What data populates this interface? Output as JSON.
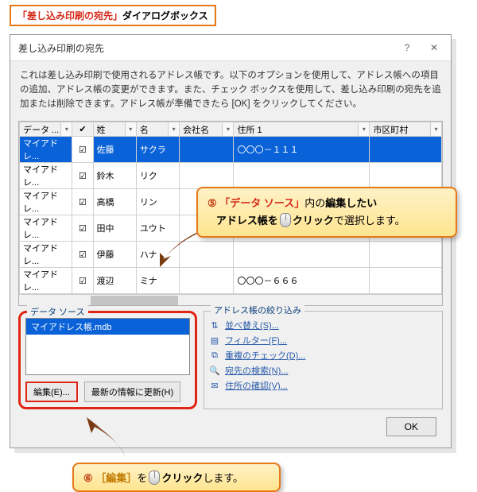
{
  "topLabel": {
    "red": "「差し込み印刷の宛先」",
    "black": "ダイアログボックス"
  },
  "dialog": {
    "title": "差し込み印刷の宛先",
    "description": "これは差し込み印刷で使用されるアドレス帳です。以下のオプションを使用して、アドレス帳への項目の追加、アドレス帳の変更ができます。また、チェック ボックスを使用して、差し込み印刷の宛先を追加または削除できます。アドレス帳が準備できたら [OK] をクリックしてください。",
    "columns": [
      "データ ...",
      "✔",
      "姓",
      "名",
      "会社名",
      "住所 1",
      "市区町村"
    ],
    "rows": [
      {
        "src": "マイアドレ...",
        "chk": true,
        "sei": "佐藤",
        "mei": "サクラ",
        "company": "",
        "addr1": "〇〇〇－１１１",
        "city": "",
        "selected": true
      },
      {
        "src": "マイアドレ...",
        "chk": true,
        "sei": "鈴木",
        "mei": "リク",
        "company": "",
        "addr1": "",
        "city": ""
      },
      {
        "src": "マイアドレ...",
        "chk": true,
        "sei": "高橋",
        "mei": "リン",
        "company": "",
        "addr1": "",
        "city": ""
      },
      {
        "src": "マイアドレ...",
        "chk": true,
        "sei": "田中",
        "mei": "ユウト",
        "company": "",
        "addr1": "",
        "city": ""
      },
      {
        "src": "マイアドレ...",
        "chk": true,
        "sei": "伊藤",
        "mei": "ハナ",
        "company": "",
        "addr1": "",
        "city": ""
      },
      {
        "src": "マイアドレ...",
        "chk": true,
        "sei": "渡辺",
        "mei": "ミナ",
        "company": "",
        "addr1": "〇〇〇－６６６",
        "city": ""
      }
    ],
    "dataSource": {
      "legend": "データ ソース",
      "item": "マイアドレス帳.mdb",
      "editBtn": "編集(E)...",
      "refreshBtn": "最新の情報に更新(H)"
    },
    "refine": {
      "legend": "アドレス帳の絞り込み",
      "links": [
        {
          "icon": "⇅",
          "text": "並べ替え(S)..."
        },
        {
          "icon": "▤",
          "text": "フィルター(F)..."
        },
        {
          "icon": "⧉",
          "text": "重複のチェック(D)..."
        },
        {
          "icon": "🔍",
          "text": "宛先の検索(N)..."
        },
        {
          "icon": "✉",
          "text": "住所の確認(V)..."
        }
      ]
    },
    "ok": "OK"
  },
  "callout5": {
    "num": "⑤",
    "r1a": "「",
    "r1b": "データ ソース",
    "r1c": "」",
    "r1d": "内の",
    "r1e": "編集したい",
    "r2a": "アドレス帳を",
    "r2b": "クリック",
    "r2c": "で選択します。"
  },
  "callout6": {
    "num": "⑥",
    "a": "［編集］",
    "b": "を",
    "c": "クリック",
    "d": "します。"
  }
}
